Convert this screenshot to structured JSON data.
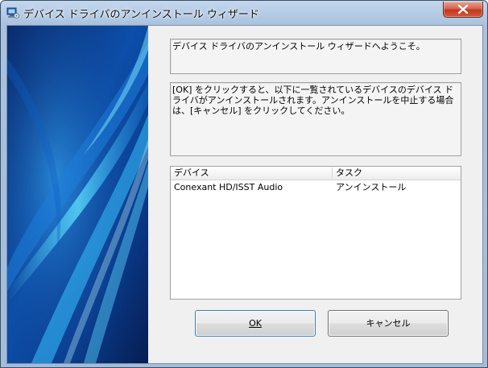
{
  "window": {
    "title": "デバイス ドライバのアンインストール ウィザード",
    "close_symbol": "✕"
  },
  "welcome_text": "デバイス ドライバのアンインストール ウィザードへようこそ。",
  "instructions_text": "[OK] をクリックすると、以下に一覧されているデバイスのデバイス ドライバがアンインストールされます。アンインストールを中止する場合は、[キャンセル] をクリックしてください。",
  "device_list": {
    "columns": [
      "デバイス",
      "タスク"
    ],
    "rows": [
      {
        "device": "Conexant HD/ISST Audio",
        "task": "アンインストール"
      }
    ]
  },
  "buttons": {
    "ok_label": "OK",
    "cancel_label": "キャンセル"
  },
  "colors": {
    "accent_blue": "#1f8fe8",
    "close_red": "#c2371f",
    "dialog_bg": "#f0f0f0"
  }
}
